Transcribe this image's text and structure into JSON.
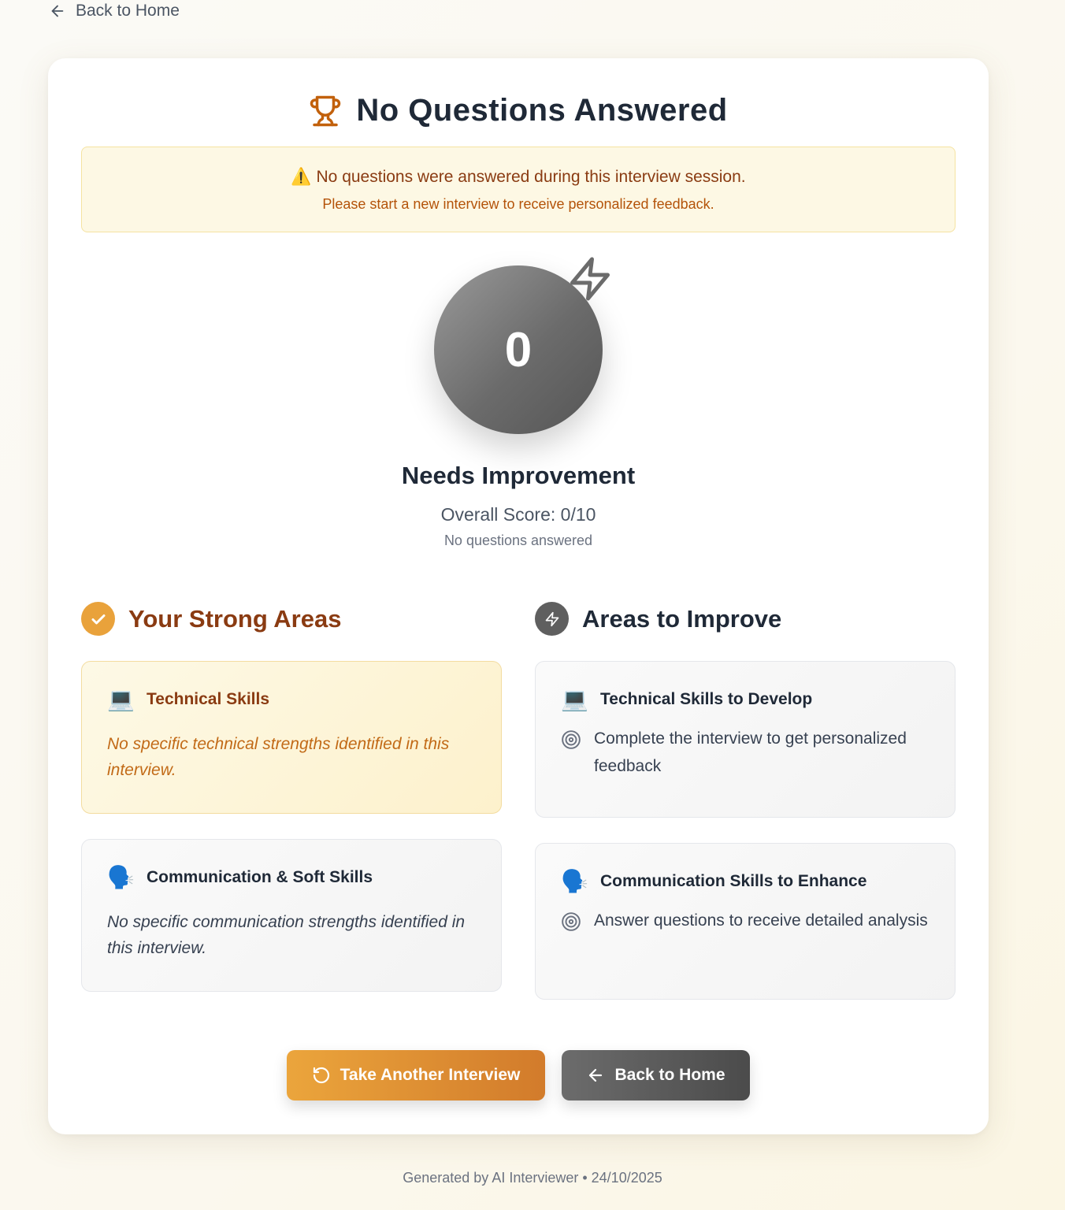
{
  "nav": {
    "back_label": "Back to Home"
  },
  "header": {
    "title": "No Questions Answered",
    "icon": "trophy-icon",
    "accent": "#c2610c"
  },
  "notice": {
    "icon": "⚠️",
    "headline": "No questions were answered during this interview session.",
    "detail": "Please start a new interview to receive personalized feedback."
  },
  "score": {
    "value": "0",
    "rating": "Needs Improvement",
    "overall": "Overall Score: 0/10",
    "note": "No questions answered"
  },
  "strong": {
    "title": "Your Strong Areas",
    "technical": {
      "emoji": "💻",
      "title": "Technical Skills",
      "text": "No specific technical strengths identified in this interview."
    },
    "communication": {
      "emoji": "🗣️",
      "title": "Communication & Soft Skills",
      "text": "No specific communication strengths identified in this interview."
    }
  },
  "improve": {
    "title": "Areas to Improve",
    "technical": {
      "emoji": "💻",
      "title": "Technical Skills to Develop",
      "item": "Complete the interview to get personalized feedback"
    },
    "communication": {
      "emoji": "🗣️",
      "title": "Communication Skills to Enhance",
      "item": "Answer questions to receive detailed analysis"
    }
  },
  "actions": {
    "retry_label": "Take Another Interview",
    "home_label": "Back to Home"
  },
  "footer": {
    "text": "Generated by AI Interviewer • 24/10/2025"
  },
  "colors": {
    "orange": "#e9a23b",
    "brown": "#8a3b12",
    "gray": "#5f5f5f"
  }
}
